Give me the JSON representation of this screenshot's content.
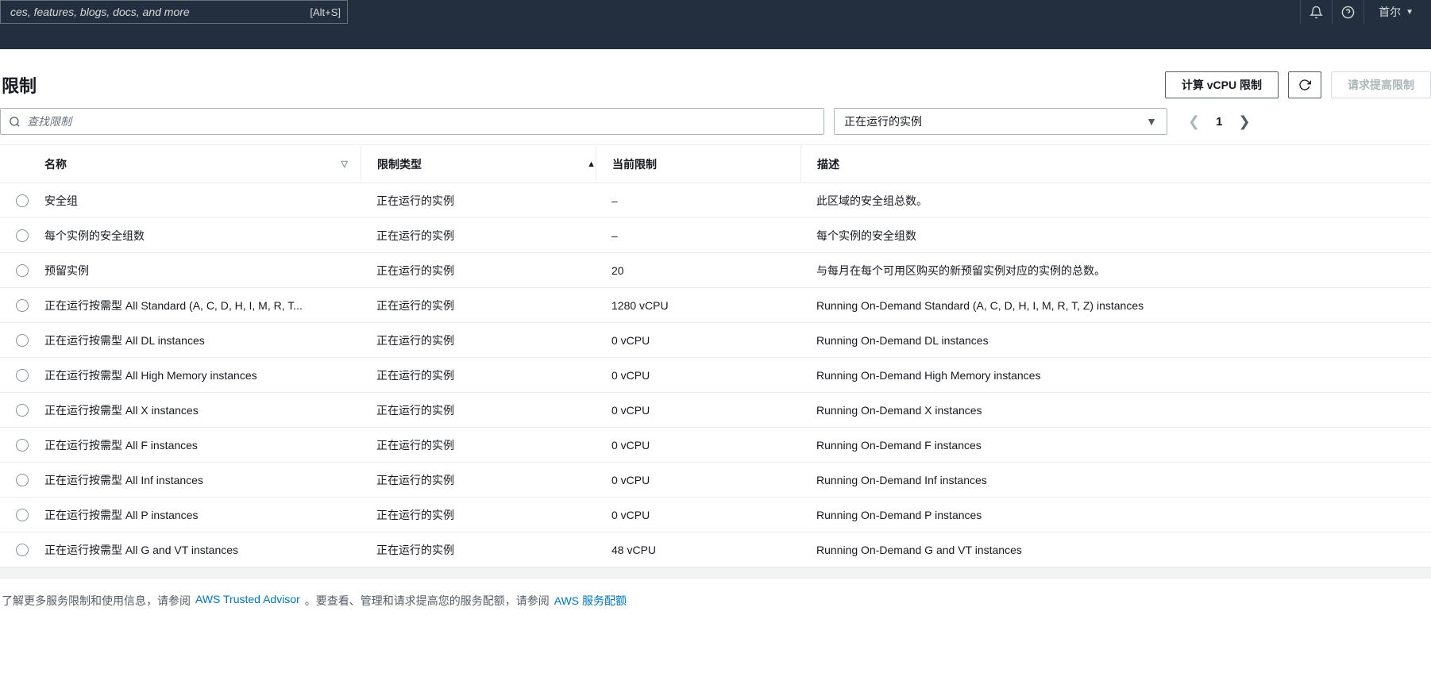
{
  "nav": {
    "search_placeholder": "ces, features, blogs, docs, and more",
    "search_hotkey": "[Alt+S]",
    "region": "首尔"
  },
  "header": {
    "title": "限制",
    "btn_calc": "计算 vCPU 限制",
    "btn_request": "请求提高限制"
  },
  "filter": {
    "search_placeholder": "查找限制",
    "dropdown_value": "正在运行的实例",
    "page_num": "1"
  },
  "columns": {
    "name": "名称",
    "type": "限制类型",
    "limit": "当前限制",
    "desc": "描述"
  },
  "rows": [
    {
      "name": "安全组",
      "type": "正在运行的实例",
      "limit": "–",
      "desc": "此区域的安全组总数。"
    },
    {
      "name": "每个实例的安全组数",
      "type": "正在运行的实例",
      "limit": "–",
      "desc": "每个实例的安全组数"
    },
    {
      "name": "预留实例",
      "type": "正在运行的实例",
      "limit": "20",
      "desc": "与每月在每个可用区购买的新预留实例对应的实例的总数。"
    },
    {
      "name": "正在运行按需型 All Standard (A, C, D, H, I, M, R, T...",
      "type": "正在运行的实例",
      "limit": "1280 vCPU",
      "desc": "Running On-Demand Standard (A, C, D, H, I, M, R, T, Z) instances"
    },
    {
      "name": "正在运行按需型 All DL instances",
      "type": "正在运行的实例",
      "limit": "0 vCPU",
      "desc": "Running On-Demand DL instances"
    },
    {
      "name": "正在运行按需型 All High Memory instances",
      "type": "正在运行的实例",
      "limit": "0 vCPU",
      "desc": "Running On-Demand High Memory instances"
    },
    {
      "name": "正在运行按需型 All X instances",
      "type": "正在运行的实例",
      "limit": "0 vCPU",
      "desc": "Running On-Demand X instances"
    },
    {
      "name": "正在运行按需型 All F instances",
      "type": "正在运行的实例",
      "limit": "0 vCPU",
      "desc": "Running On-Demand F instances"
    },
    {
      "name": "正在运行按需型 All Inf instances",
      "type": "正在运行的实例",
      "limit": "0 vCPU",
      "desc": "Running On-Demand Inf instances"
    },
    {
      "name": "正在运行按需型 All P instances",
      "type": "正在运行的实例",
      "limit": "0 vCPU",
      "desc": "Running On-Demand P instances"
    },
    {
      "name": "正在运行按需型 All G and VT instances",
      "type": "正在运行的实例",
      "limit": "48 vCPU",
      "desc": "Running On-Demand G and VT instances"
    }
  ],
  "footer": {
    "t1": "了解更多服务限制和使用信息，请参阅",
    "l1": "AWS Trusted Advisor",
    "t2": "。要查看、管理和请求提高您的服务配额，请参阅",
    "l2": "AWS 服务配额"
  }
}
